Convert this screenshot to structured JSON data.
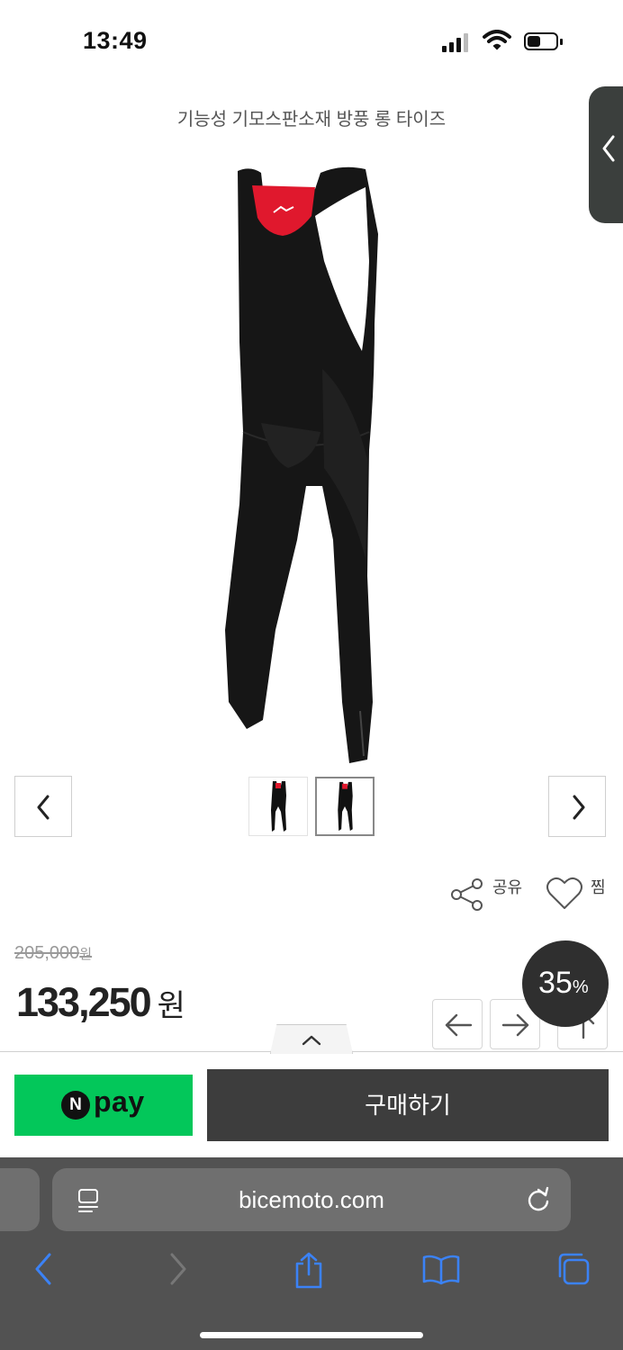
{
  "status_bar": {
    "time": "13:49"
  },
  "product": {
    "title": "기능성 기모스판소재 방풍 롱 타이즈",
    "image_icon": "bib-tights-image",
    "thumbnail_count": 2,
    "selected_thumbnail": 2
  },
  "actions": {
    "share_label": "공유",
    "wishlist_label": "찜"
  },
  "price": {
    "original": "205,000",
    "original_unit": "원",
    "sale": "133,250",
    "sale_unit": "원",
    "discount_value": "35",
    "discount_unit": "%"
  },
  "purchase": {
    "npay_badge": "N",
    "npay_label": "pay",
    "buy_label": "구매하기"
  },
  "browser": {
    "url": "bicemoto.com"
  },
  "colors": {
    "npay_green": "#03c75a",
    "buy_button": "#3d3d3d",
    "safari_toolbar": "#525252",
    "safari_accent": "#3b82f6",
    "discount_badge": "#2f2f2f"
  }
}
